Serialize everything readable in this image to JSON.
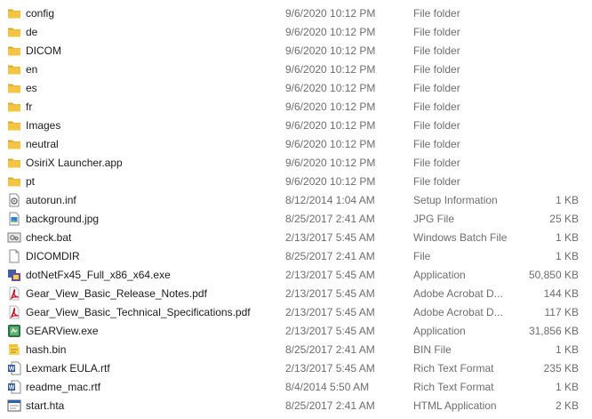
{
  "files": [
    {
      "name": "config",
      "date": "9/6/2020 10:12 PM",
      "type": "File folder",
      "size": "",
      "icon": "folder-icon"
    },
    {
      "name": "de",
      "date": "9/6/2020 10:12 PM",
      "type": "File folder",
      "size": "",
      "icon": "folder-icon"
    },
    {
      "name": "DICOM",
      "date": "9/6/2020 10:12 PM",
      "type": "File folder",
      "size": "",
      "icon": "folder-icon"
    },
    {
      "name": "en",
      "date": "9/6/2020 10:12 PM",
      "type": "File folder",
      "size": "",
      "icon": "folder-icon"
    },
    {
      "name": "es",
      "date": "9/6/2020 10:12 PM",
      "type": "File folder",
      "size": "",
      "icon": "folder-icon"
    },
    {
      "name": "fr",
      "date": "9/6/2020 10:12 PM",
      "type": "File folder",
      "size": "",
      "icon": "folder-icon"
    },
    {
      "name": "Images",
      "date": "9/6/2020 10:12 PM",
      "type": "File folder",
      "size": "",
      "icon": "folder-icon"
    },
    {
      "name": "neutral",
      "date": "9/6/2020 10:12 PM",
      "type": "File folder",
      "size": "",
      "icon": "folder-icon"
    },
    {
      "name": "OsiriX Launcher.app",
      "date": "9/6/2020 10:12 PM",
      "type": "File folder",
      "size": "",
      "icon": "folder-icon"
    },
    {
      "name": "pt",
      "date": "9/6/2020 10:12 PM",
      "type": "File folder",
      "size": "",
      "icon": "folder-icon"
    },
    {
      "name": "autorun.inf",
      "date": "8/12/2014 1:04 AM",
      "type": "Setup Information",
      "size": "1 KB",
      "icon": "setup-file-icon"
    },
    {
      "name": "background.jpg",
      "date": "8/25/2017 2:41 AM",
      "type": "JPG File",
      "size": "25 KB",
      "icon": "image-file-icon"
    },
    {
      "name": "check.bat",
      "date": "2/13/2017 5:45 AM",
      "type": "Windows Batch File",
      "size": "1 KB",
      "icon": "batch-file-icon"
    },
    {
      "name": "DICOMDIR",
      "date": "8/25/2017 2:41 AM",
      "type": "File",
      "size": "1 KB",
      "icon": "blank-file-icon"
    },
    {
      "name": "dotNetFx45_Full_x86_x64.exe",
      "date": "2/13/2017 5:45 AM",
      "type": "Application",
      "size": "50,850 KB",
      "icon": "installer-icon"
    },
    {
      "name": "Gear_View_Basic_Release_Notes.pdf",
      "date": "2/13/2017 5:45 AM",
      "type": "Adobe Acrobat D...",
      "size": "144 KB",
      "icon": "pdf-icon"
    },
    {
      "name": "Gear_View_Basic_Technical_Specifications.pdf",
      "date": "2/13/2017 5:45 AM",
      "type": "Adobe Acrobat D...",
      "size": "117 KB",
      "icon": "pdf-icon"
    },
    {
      "name": "GEARView.exe",
      "date": "2/13/2017 5:45 AM",
      "type": "Application",
      "size": "31,856 KB",
      "icon": "app-icon"
    },
    {
      "name": "hash.bin",
      "date": "8/25/2017 2:41 AM",
      "type": "BIN File",
      "size": "1 KB",
      "icon": "bin-file-icon"
    },
    {
      "name": "Lexmark EULA.rtf",
      "date": "2/13/2017 5:45 AM",
      "type": "Rich Text Format",
      "size": "235 KB",
      "icon": "word-doc-icon"
    },
    {
      "name": "readme_mac.rtf",
      "date": "8/4/2014 5:50 AM",
      "type": "Rich Text Format",
      "size": "1 KB",
      "icon": "word-doc-icon"
    },
    {
      "name": "start.hta",
      "date": "8/25/2017 2:41 AM",
      "type": "HTML Application",
      "size": "2 KB",
      "icon": "hta-file-icon"
    }
  ],
  "colors": {
    "folder": "#f4c542",
    "folder_dark": "#dca82a",
    "pdf_red": "#d0021b",
    "word_blue": "#2b579a",
    "text": "#1a1a1a",
    "meta_text": "#6d6d6d"
  }
}
